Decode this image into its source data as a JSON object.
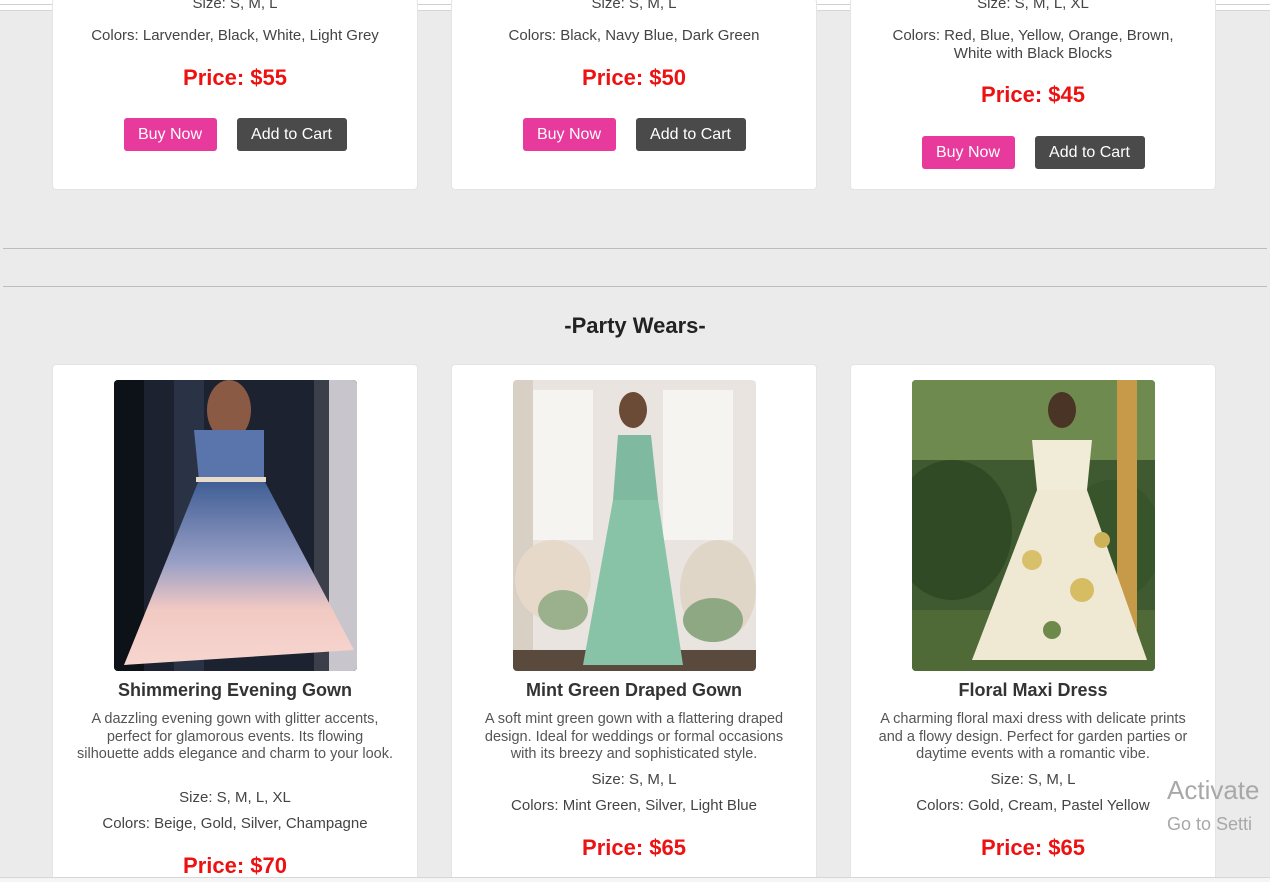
{
  "top_row": [
    {
      "size": "Size: S, M, L",
      "colors": "Colors: Larvender, Black, White, Light Grey",
      "price": "Price: $55",
      "buy": "Buy Now",
      "cart": "Add to Cart"
    },
    {
      "size": "Size: S, M, L",
      "colors": "Colors: Black, Navy Blue, Dark Green",
      "price": "Price: $50",
      "buy": "Buy Now",
      "cart": "Add to Cart"
    },
    {
      "size": "Size: S, M, L, XL",
      "colors": "Colors: Red, Blue, Yellow, Orange, Brown, White with Black Blocks",
      "price": "Price: $45",
      "buy": "Buy Now",
      "cart": "Add to Cart"
    }
  ],
  "section": {
    "title": "-Party Wears-"
  },
  "party_wears": [
    {
      "name": "Shimmering Evening Gown",
      "description": "A dazzling evening gown with glitter accents, perfect for glamorous events. Its flowing silhouette adds elegance and charm to your look.",
      "size": "Size: S, M, L, XL",
      "colors": "Colors: Beige, Gold, Silver, Champagne",
      "price": "Price: $70"
    },
    {
      "name": "Mint Green Draped Gown",
      "description": "A soft mint green gown with a flattering draped design. Ideal for weddings or formal occasions with its breezy and sophisticated style.",
      "size": "Size: S, M, L",
      "colors": "Colors: Mint Green, Silver, Light Blue",
      "price": "Price: $65"
    },
    {
      "name": "Floral Maxi Dress",
      "description": "A charming floral maxi dress with delicate prints and a flowy design. Perfect for garden parties or daytime events with a romantic vibe.",
      "size": "Size: S, M, L",
      "colors": "Colors: Gold, Cream, Pastel Yellow",
      "price": "Price: $65"
    }
  ],
  "watermark": {
    "line1": "Activate",
    "line2": "Go to Setti"
  },
  "colors": {
    "buy_button": "#e8399c",
    "cart_button": "#4a4a4a",
    "price": "#ee1111",
    "background": "#ebebeb"
  }
}
